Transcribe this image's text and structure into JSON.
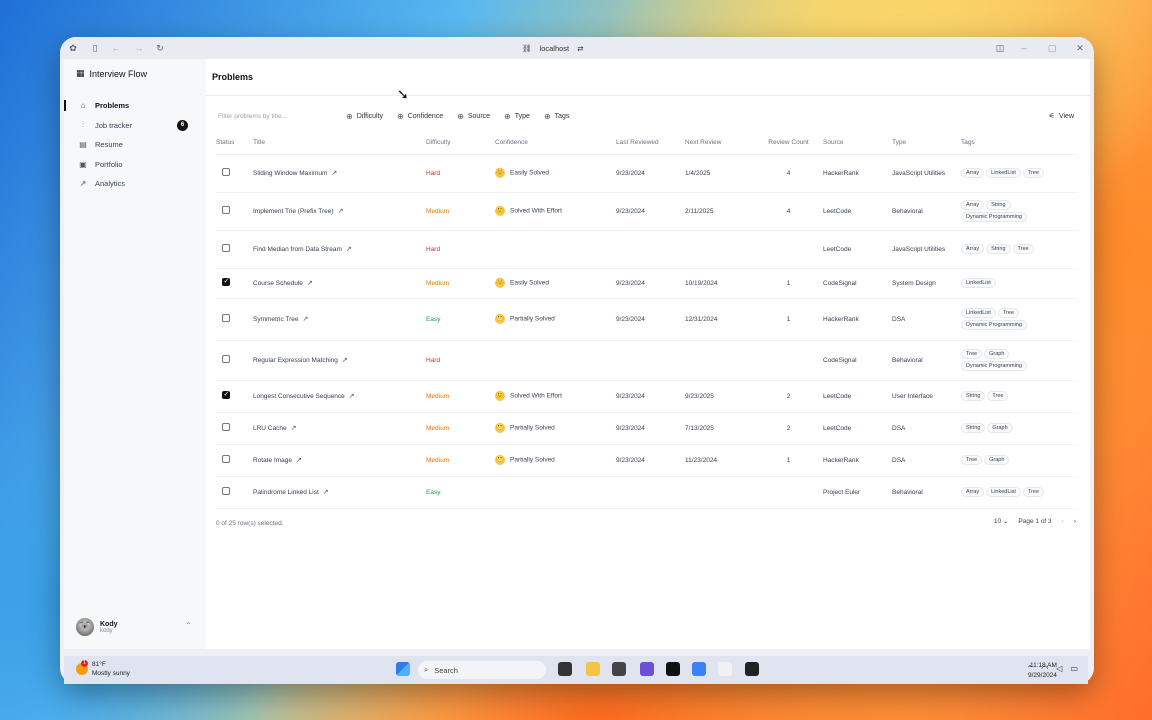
{
  "browser": {
    "url": "localhost"
  },
  "app": {
    "name": "Interview Flow"
  },
  "sidebar": {
    "items": [
      {
        "label": "Problems",
        "icon": "home-icon",
        "active": true
      },
      {
        "label": "Job tracker",
        "icon": "kanban-icon",
        "badge": "6"
      },
      {
        "label": "Resume",
        "icon": "document-icon"
      },
      {
        "label": "Portfolio",
        "icon": "portfolio-icon"
      },
      {
        "label": "Analytics",
        "icon": "chart-icon"
      }
    ],
    "user": {
      "name": "Kody",
      "sub": "kody"
    }
  },
  "page": {
    "title": "Problems",
    "filter_placeholder": "Filter problems by title...",
    "filters": [
      "Difficulty",
      "Confidence",
      "Source",
      "Type",
      "Tags"
    ],
    "view_label": "View"
  },
  "table": {
    "headers": [
      "Status",
      "Title",
      "Difficulty",
      "Confidence",
      "Last Reviewed",
      "Next Review",
      "Review Count",
      "Source",
      "Type",
      "Tags"
    ],
    "rows": [
      {
        "checked": false,
        "title": "Sliding Window Maximum",
        "difficulty": "Hard",
        "confidence": "Easily Solved",
        "conf_icon": "crown-icon",
        "last": "9/23/2024",
        "next": "1/4/2025",
        "count": "4",
        "source": "HackerRank",
        "type": "JavaScript Utilities",
        "tags": [
          "Array",
          "LinkedList",
          "Tree"
        ]
      },
      {
        "checked": false,
        "title": "Implement Trie (Prefix Tree)",
        "difficulty": "Medium",
        "confidence": "Solved With Effort",
        "conf_icon": "smile-icon",
        "last": "9/23/2024",
        "next": "2/11/2025",
        "count": "4",
        "source": "LeetCode",
        "type": "Behavioral",
        "tags": [
          "Array",
          "String",
          "Dynamic Programming"
        ]
      },
      {
        "checked": false,
        "title": "Find Median from Data Stream",
        "difficulty": "Hard",
        "confidence": "",
        "conf_icon": "",
        "last": "",
        "next": "",
        "count": "",
        "source": "LeetCode",
        "type": "JavaScript Utilities",
        "tags": [
          "Array",
          "String",
          "Tree"
        ]
      },
      {
        "checked": true,
        "title": "Course Schedule",
        "difficulty": "Medium",
        "confidence": "Easily Solved",
        "conf_icon": "crown-icon",
        "last": "9/23/2024",
        "next": "10/19/2024",
        "count": "1",
        "source": "CodeSignal",
        "type": "System Design",
        "tags": [
          "LinkedList"
        ]
      },
      {
        "checked": false,
        "title": "Symmetric Tree",
        "difficulty": "Easy",
        "confidence": "Partially Solved",
        "conf_icon": "grimace-icon",
        "last": "9/23/2024",
        "next": "12/31/2024",
        "count": "1",
        "source": "HackerRank",
        "type": "DSA",
        "tags": [
          "LinkedList",
          "Tree",
          "Dynamic Programming"
        ]
      },
      {
        "checked": false,
        "title": "Regular Expression Matching",
        "difficulty": "Hard",
        "confidence": "",
        "conf_icon": "",
        "last": "",
        "next": "",
        "count": "",
        "source": "CodeSignal",
        "type": "Behavioral",
        "tags": [
          "Tree",
          "Graph",
          "Dynamic Programming"
        ]
      },
      {
        "checked": true,
        "title": "Longest Consecutive Sequence",
        "difficulty": "Medium",
        "confidence": "Solved With Effort",
        "conf_icon": "smile-icon",
        "last": "9/23/2024",
        "next": "9/23/2025",
        "count": "2",
        "source": "LeetCode",
        "type": "User Interface",
        "tags": [
          "String",
          "Tree"
        ]
      },
      {
        "checked": false,
        "title": "LRU Cache",
        "difficulty": "Medium",
        "confidence": "Partially Solved",
        "conf_icon": "grimace-icon",
        "last": "9/23/2024",
        "next": "7/13/2025",
        "count": "2",
        "source": "LeetCode",
        "type": "DSA",
        "tags": [
          "String",
          "Graph"
        ]
      },
      {
        "checked": false,
        "title": "Rotate Image",
        "difficulty": "Medium",
        "confidence": "Partially Solved",
        "conf_icon": "grimace-icon",
        "last": "9/23/2024",
        "next": "11/23/2024",
        "count": "1",
        "source": "HackerRank",
        "type": "DSA",
        "tags": [
          "Tree",
          "Graph"
        ]
      },
      {
        "checked": false,
        "title": "Palindrome Linked List",
        "difficulty": "Easy",
        "confidence": "",
        "conf_icon": "",
        "last": "",
        "next": "",
        "count": "",
        "source": "Project Euler",
        "type": "Behavioral",
        "tags": [
          "Array",
          "LinkedList",
          "Tree"
        ]
      }
    ]
  },
  "footer": {
    "selected": "0 of 25 row(s) selected.",
    "page_size": "10",
    "page_info": "Page 1 of 3"
  },
  "taskbar": {
    "weather_temp": "81°F",
    "weather_desc": "Mostly sunny",
    "weather_badge": "1",
    "search_label": "Search",
    "time": "11:18 AM",
    "date": "9/29/2024"
  },
  "colors": {
    "hard": "#dc2626",
    "medium": "#d97706",
    "easy": "#16a34a"
  }
}
